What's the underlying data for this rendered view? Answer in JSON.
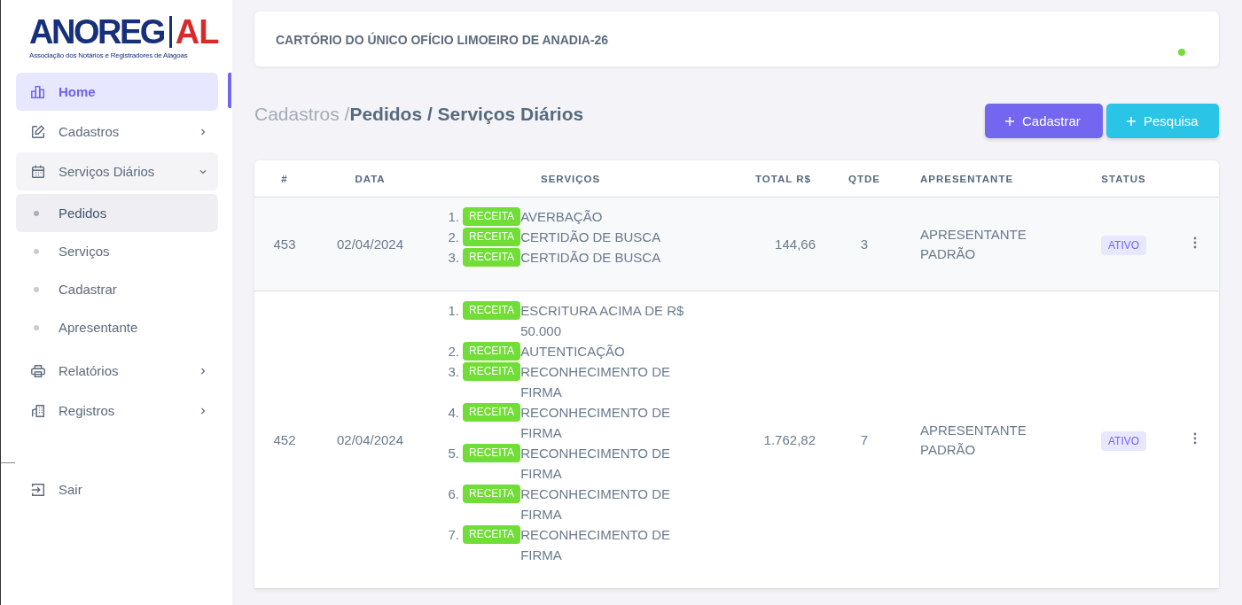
{
  "logo": {
    "brand_left": "ANOREG",
    "brand_right": "AL",
    "tagline": "Associação dos Notários e Registradores de Alagoas"
  },
  "sidebar": {
    "items": [
      {
        "label": "Home",
        "selected": true
      },
      {
        "label": "Cadastros",
        "selected": false,
        "expanded": false
      },
      {
        "label": "Serviços Diários",
        "selected": false,
        "expanded": true,
        "children": [
          {
            "label": "Pedidos",
            "selected": true
          },
          {
            "label": "Serviços",
            "selected": false
          },
          {
            "label": "Cadastrar",
            "selected": false
          },
          {
            "label": "Apresentante",
            "selected": false
          }
        ]
      },
      {
        "label": "Relatórios",
        "selected": false,
        "expanded": false
      },
      {
        "label": "Registros",
        "selected": false,
        "expanded": false
      }
    ],
    "logout": {
      "label": "Sair"
    }
  },
  "header": {
    "title": "CARTÓRIO DO ÚNICO OFÍCIO LIMOEIRO DE ANADIA-26",
    "online": true
  },
  "breadcrumb": {
    "parent": "Cadastros /",
    "current": "Pedidos / Serviços Diários"
  },
  "buttons": [
    {
      "label": "Cadastrar",
      "color": "#7367f0"
    },
    {
      "label": "Pesquisa",
      "color": "#2ac4e6"
    }
  ],
  "table": {
    "columns": [
      "#",
      "DATA",
      "SERVIÇOS",
      "TOTAL R$",
      "QTDE",
      "APRESENTANTE",
      "STATUS"
    ],
    "rows": [
      {
        "id": "453",
        "date": "02/04/2024",
        "total": "144,66",
        "qty": "3",
        "presenter": "APRESENTANTE PADRÃO",
        "status": "ATIVO",
        "services": [
          {
            "number": "1.",
            "tag": "RECEITA",
            "name": "AVERBAÇÃO"
          },
          {
            "number": "2.",
            "tag": "RECEITA",
            "name": "CERTIDÃO DE BUSCA"
          },
          {
            "number": "3.",
            "tag": "RECEITA",
            "name": "CERTIDÃO DE BUSCA"
          }
        ]
      },
      {
        "id": "452",
        "date": "02/04/2024",
        "total": "1.762,82",
        "qty": "7",
        "presenter": "APRESENTANTE PADRÃO",
        "status": "ATIVO",
        "services": [
          {
            "number": "1.",
            "tag": "RECEITA",
            "name": "ESCRITURA ACIMA DE R$ 50.000"
          },
          {
            "number": "2.",
            "tag": "RECEITA",
            "name": "AUTENTICAÇÃO"
          },
          {
            "number": "3.",
            "tag": "RECEITA",
            "name": "RECONHECIMENTO DE FIRMA"
          },
          {
            "number": "4.",
            "tag": "RECEITA",
            "name": "RECONHECIMENTO DE FIRMA"
          },
          {
            "number": "5.",
            "tag": "RECEITA",
            "name": "RECONHECIMENTO DE FIRMA"
          },
          {
            "number": "6.",
            "tag": "RECEITA",
            "name": "RECONHECIMENTO DE FIRMA"
          },
          {
            "number": "7.",
            "tag": "RECEITA",
            "name": "RECONHECIMENTO DE FIRMA"
          }
        ]
      }
    ]
  }
}
